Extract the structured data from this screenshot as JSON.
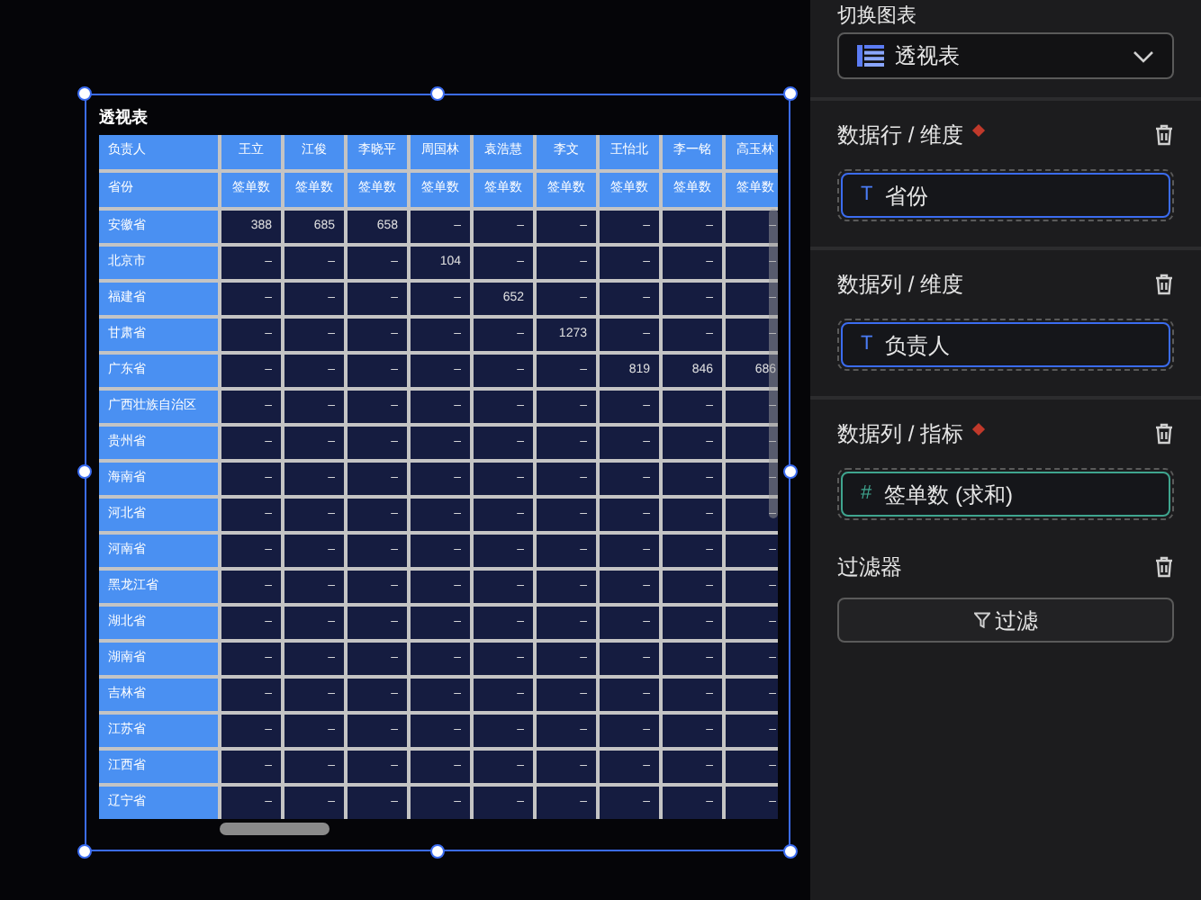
{
  "widget": {
    "title": "透视表",
    "header_rows": [
      {
        "label": "负责人",
        "cells": [
          "王立",
          "江俊",
          "李晓平",
          "周国林",
          "袁浩慧",
          "李文",
          "王怡北",
          "李一铭",
          "高玉林"
        ]
      },
      {
        "label": "省份",
        "cells": [
          "签单数",
          "签单数",
          "签单数",
          "签单数",
          "签单数",
          "签单数",
          "签单数",
          "签单数",
          "签单数"
        ]
      }
    ],
    "rows": [
      {
        "label": "安徽省",
        "cells": [
          "388",
          "685",
          "658",
          "–",
          "–",
          "–",
          "–",
          "–",
          "–"
        ]
      },
      {
        "label": "北京市",
        "cells": [
          "–",
          "–",
          "–",
          "104",
          "–",
          "–",
          "–",
          "–",
          "–"
        ]
      },
      {
        "label": "福建省",
        "cells": [
          "–",
          "–",
          "–",
          "–",
          "652",
          "–",
          "–",
          "–",
          "–"
        ]
      },
      {
        "label": "甘肃省",
        "cells": [
          "–",
          "–",
          "–",
          "–",
          "–",
          "1273",
          "–",
          "–",
          "–"
        ]
      },
      {
        "label": "广东省",
        "cells": [
          "–",
          "–",
          "–",
          "–",
          "–",
          "–",
          "819",
          "846",
          "686"
        ]
      },
      {
        "label": "广西壮族自治区",
        "cells": [
          "–",
          "–",
          "–",
          "–",
          "–",
          "–",
          "–",
          "–",
          "–"
        ]
      },
      {
        "label": "贵州省",
        "cells": [
          "–",
          "–",
          "–",
          "–",
          "–",
          "–",
          "–",
          "–",
          "–"
        ]
      },
      {
        "label": "海南省",
        "cells": [
          "–",
          "–",
          "–",
          "–",
          "–",
          "–",
          "–",
          "–",
          "–"
        ]
      },
      {
        "label": "河北省",
        "cells": [
          "–",
          "–",
          "–",
          "–",
          "–",
          "–",
          "–",
          "–",
          "–"
        ]
      },
      {
        "label": "河南省",
        "cells": [
          "–",
          "–",
          "–",
          "–",
          "–",
          "–",
          "–",
          "–",
          "–"
        ]
      },
      {
        "label": "黑龙江省",
        "cells": [
          "–",
          "–",
          "–",
          "–",
          "–",
          "–",
          "–",
          "–",
          "–"
        ]
      },
      {
        "label": "湖北省",
        "cells": [
          "–",
          "–",
          "–",
          "–",
          "–",
          "–",
          "–",
          "–",
          "–"
        ]
      },
      {
        "label": "湖南省",
        "cells": [
          "–",
          "–",
          "–",
          "–",
          "–",
          "–",
          "–",
          "–",
          "–"
        ]
      },
      {
        "label": "吉林省",
        "cells": [
          "–",
          "–",
          "–",
          "–",
          "–",
          "–",
          "–",
          "–",
          "–"
        ]
      },
      {
        "label": "江苏省",
        "cells": [
          "–",
          "–",
          "–",
          "–",
          "–",
          "–",
          "–",
          "–",
          "–"
        ]
      },
      {
        "label": "江西省",
        "cells": [
          "–",
          "–",
          "–",
          "–",
          "–",
          "–",
          "–",
          "–",
          "–"
        ]
      },
      {
        "label": "辽宁省",
        "cells": [
          "–",
          "–",
          "–",
          "–",
          "–",
          "–",
          "–",
          "–",
          "–"
        ]
      }
    ]
  },
  "panel": {
    "chart_switch": {
      "label": "切换图表",
      "value": "透视表"
    },
    "sections": [
      {
        "title": "数据行 / 维度",
        "required": true,
        "field": {
          "kind": "dimension",
          "icon_text": "T",
          "label": "省份"
        }
      },
      {
        "title": "数据列 / 维度",
        "required": false,
        "field": {
          "kind": "dimension",
          "icon_text": "T",
          "label": "负责人"
        }
      },
      {
        "title": "数据列 / 指标",
        "required": true,
        "field": {
          "kind": "measure",
          "icon_text": "#",
          "label": "签单数 (求和)"
        }
      },
      {
        "title": "过滤器",
        "required": false,
        "button": "过滤"
      }
    ]
  }
}
